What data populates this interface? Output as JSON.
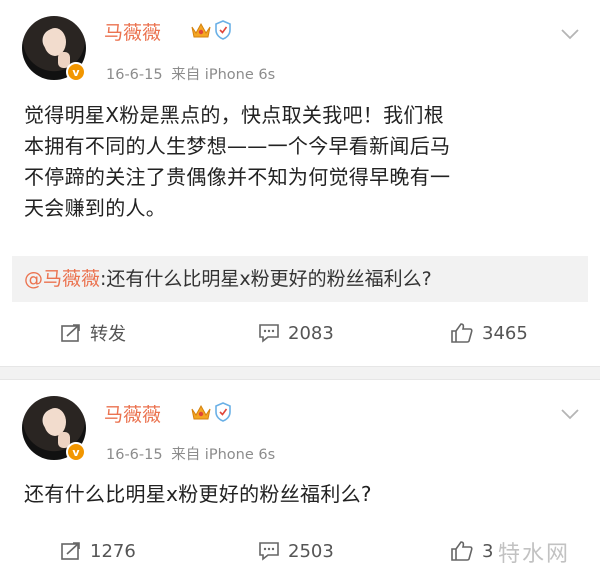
{
  "posts": [
    {
      "username": "马薇薇",
      "vip_badge": "v",
      "date": "16-6-15",
      "source": "来自 iPhone 6s",
      "content_lines": [
        "觉得明星X粉是黑点的，快点取关我吧！我们根",
        "本拥有不同的人生梦想——一个今早看新闻后马",
        "不停蹄的关注了贵偶像并不知为何觉得早晚有一",
        "天会赚到的人。"
      ],
      "quote": {
        "mention": "@马薇薇",
        "text": ":还有什么比明星x粉更好的粉丝福利么?"
      },
      "actions": {
        "repost": "转发",
        "comments": "2083",
        "likes": "3465"
      }
    },
    {
      "username": "马薇薇",
      "vip_badge": "v",
      "date": "16-6-15",
      "source": "来自 iPhone 6s",
      "content_lines": [
        "还有什么比明星x粉更好的粉丝福利么?"
      ],
      "actions": {
        "repost": "1276",
        "comments": "2503",
        "likes": "3"
      }
    }
  ],
  "icons": {
    "crown": "crown-icon",
    "shield": "shield-icon",
    "chevron": "chevron-down-icon",
    "repost": "repost-icon",
    "comment": "comment-icon",
    "like": "like-icon"
  },
  "colors": {
    "username": "#eb7350",
    "meta": "#8c8c8c",
    "badge": "#f29600",
    "quote_bg": "#f2f2f2",
    "separator": "#f2f2f2"
  },
  "watermark": "特水网"
}
